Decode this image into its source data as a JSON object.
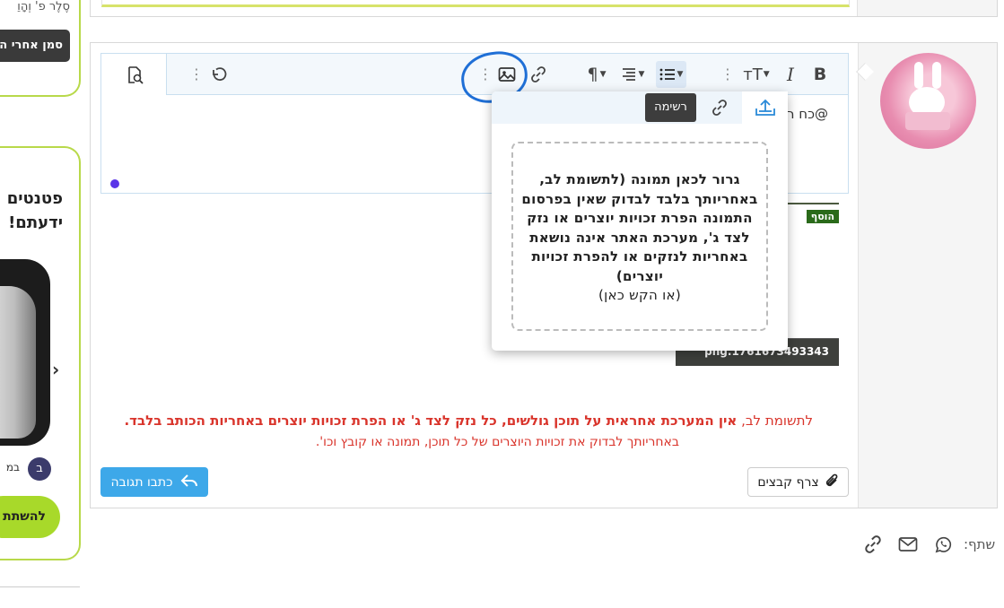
{
  "sidebar": {
    "top_text": "סֶלֶר פ' וְהָוֵ",
    "mark_button": "סמן אחרי ה",
    "promo_title": "פטנטים\nידעתם! ",
    "author_initial": "ב",
    "author_text": "במ",
    "cta_button": "להשתת",
    "next_arrow": "›"
  },
  "editor": {
    "content_text": "@כח ר",
    "toolbar": {
      "bold": "B",
      "italic": "I",
      "font_size": "тT",
      "paragraph": "¶",
      "more_dots": "⋮"
    }
  },
  "popup": {
    "tooltip": "רשימה",
    "dropzone_bold": "גרור לכאן תמונה (לתשומת לב, באחריותך בלבד לבדוק שאין בפרסום התמונה הפרת זכויות יוצרים או נזק לצד ג', מערכת האתר אינה נושאת באחריות לנזקים או להפרת זכויות יוצרים)",
    "dropzone_sub": "(או הקש כאן)"
  },
  "attachment": {
    "filename": "png.1761673493343",
    "thumb_label": "הוסף"
  },
  "disclaimer": {
    "prefix": "לתשומת לב, ",
    "bold": "אין המערכת אחראית על תוכן גולשים, כל נזק לצד ג' או הפרת זכויות יוצרים באחריות הכותב בלבד.",
    "line2": "באחריותך לבדוק את זכויות היוצרים של כל תוכן, תמונה או קובץ וכו'."
  },
  "buttons": {
    "attach": "צרף קבצים",
    "reply": "כתבו תגובה"
  },
  "share": {
    "label": "שתף:",
    "icons": [
      "whatsapp-icon",
      "mail-icon",
      "link-icon"
    ]
  },
  "colors": {
    "accent": "#3da8e9",
    "warning": "#d9342b",
    "green": "#a8d92a",
    "annotation": "#1f6fd6"
  }
}
